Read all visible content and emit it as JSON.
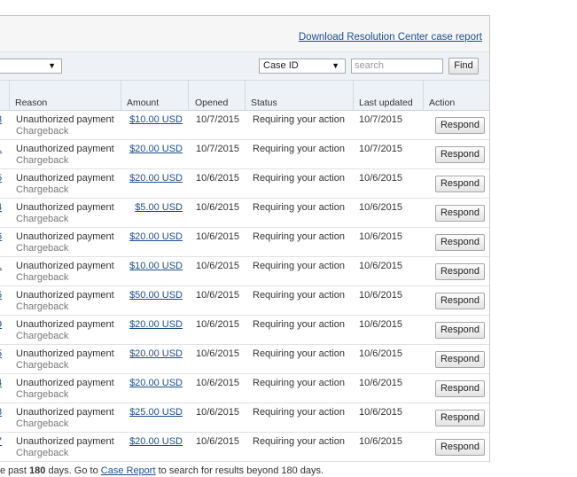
{
  "header": {
    "download_link": "Download Resolution Center case report"
  },
  "filters": {
    "left_select_value": "",
    "search_by_value": "Case ID",
    "search_placeholder": "search",
    "find_label": "Find"
  },
  "table": {
    "columns": [
      "Reason",
      "Amount",
      "Opened",
      "Status",
      "Last updated",
      "Action"
    ],
    "rows": [
      {
        "id_fragment": "3",
        "reason": "Unauthorized payment",
        "sub": "Chargeback",
        "amount": "$10.00 USD",
        "opened": "10/7/2015",
        "status": "Requiring your action",
        "updated": "10/7/2015",
        "action": "Respond"
      },
      {
        "id_fragment": "1",
        "reason": "Unauthorized payment",
        "sub": "Chargeback",
        "amount": "$20.00 USD",
        "opened": "10/7/2015",
        "status": "Requiring your action",
        "updated": "10/7/2015",
        "action": "Respond"
      },
      {
        "id_fragment": "5",
        "reason": "Unauthorized payment",
        "sub": "Chargeback",
        "amount": "$20.00 USD",
        "opened": "10/6/2015",
        "status": "Requiring your action",
        "updated": "10/6/2015",
        "action": "Respond"
      },
      {
        "id_fragment": "4",
        "reason": "Unauthorized payment",
        "sub": "Chargeback",
        "amount": "$5.00 USD",
        "opened": "10/6/2015",
        "status": "Requiring your action",
        "updated": "10/6/2015",
        "action": "Respond"
      },
      {
        "id_fragment": "6",
        "reason": "Unauthorized payment",
        "sub": "Chargeback",
        "amount": "$20.00 USD",
        "opened": "10/6/2015",
        "status": "Requiring your action",
        "updated": "10/6/2015",
        "action": "Respond"
      },
      {
        "id_fragment": "1",
        "reason": "Unauthorized payment",
        "sub": "Chargeback",
        "amount": "$10.00 USD",
        "opened": "10/6/2015",
        "status": "Requiring your action",
        "updated": "10/6/2015",
        "action": "Respond"
      },
      {
        "id_fragment": "5",
        "reason": "Unauthorized payment",
        "sub": "Chargeback",
        "amount": "$50.00 USD",
        "opened": "10/6/2015",
        "status": "Requiring your action",
        "updated": "10/6/2015",
        "action": "Respond"
      },
      {
        "id_fragment": "9",
        "reason": "Unauthorized payment",
        "sub": "Chargeback",
        "amount": "$20.00 USD",
        "opened": "10/6/2015",
        "status": "Requiring your action",
        "updated": "10/6/2015",
        "action": "Respond"
      },
      {
        "id_fragment": "5",
        "reason": "Unauthorized payment",
        "sub": "Chargeback",
        "amount": "$20.00 USD",
        "opened": "10/6/2015",
        "status": "Requiring your action",
        "updated": "10/6/2015",
        "action": "Respond"
      },
      {
        "id_fragment": "4",
        "reason": "Unauthorized payment",
        "sub": "Chargeback",
        "amount": "$20.00 USD",
        "opened": "10/6/2015",
        "status": "Requiring your action",
        "updated": "10/6/2015",
        "action": "Respond"
      },
      {
        "id_fragment": "3",
        "reason": "Unauthorized payment",
        "sub": "Chargeback",
        "amount": "$25.00 USD",
        "opened": "10/6/2015",
        "status": "Requiring your action",
        "updated": "10/6/2015",
        "action": "Respond"
      },
      {
        "id_fragment": "7",
        "reason": "Unauthorized payment",
        "sub": "Chargeback",
        "amount": "$20.00 USD",
        "opened": "10/6/2015",
        "status": "Requiring your action",
        "updated": "10/6/2015",
        "action": "Respond"
      }
    ]
  },
  "footer": {
    "prefix": "e past ",
    "days": "180",
    "middle": " days. Go to ",
    "link": "Case Report",
    "suffix": " to search for results beyond 180 days."
  },
  "colors": {
    "link": "#1a4f8f",
    "header_bg": "#eef2f6"
  }
}
